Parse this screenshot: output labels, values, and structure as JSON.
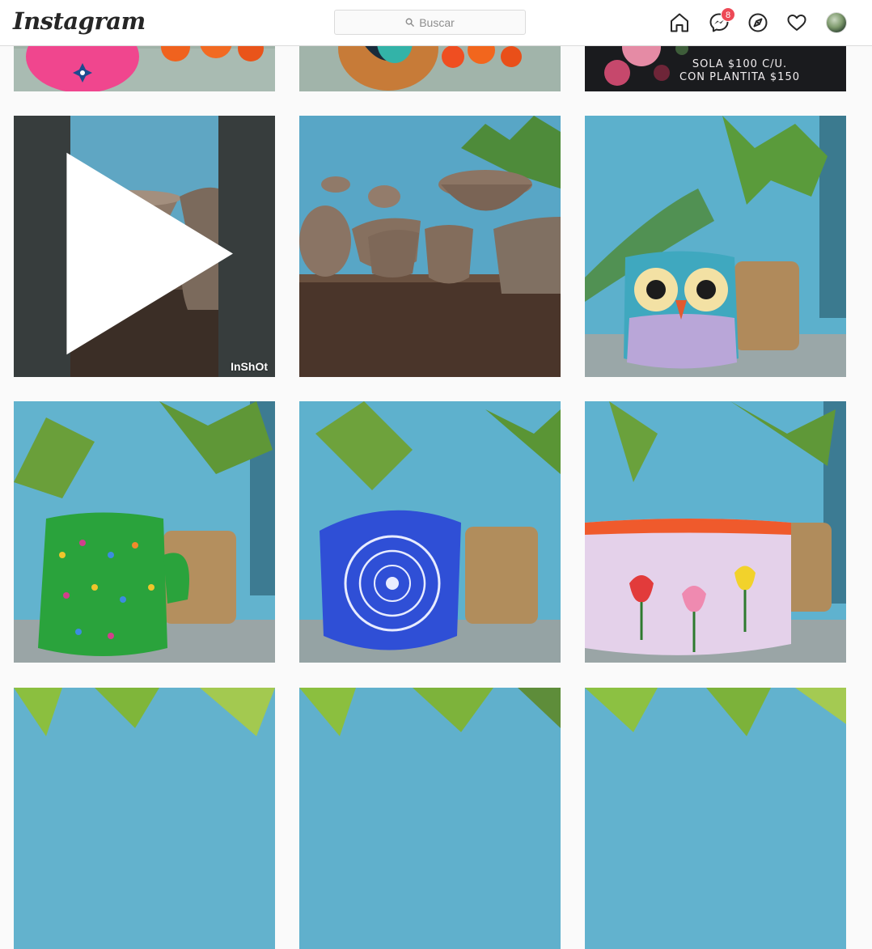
{
  "header": {
    "logo_text": "Instagram",
    "search_placeholder": "Buscar",
    "messages_badge": "8",
    "icons": [
      "home-icon",
      "messenger-icon",
      "explore-icon",
      "activity-heart-icon",
      "profile-avatar"
    ]
  },
  "posts": {
    "p1": {
      "subject": "pink-painted-pot-with-orange-flowers"
    },
    "p2": {
      "subject": "painted-terracotta-pot-turquoise"
    },
    "p3": {
      "promo_line1": "SOLA $100 C/U.",
      "promo_line2": "CON PLANTITA $150"
    },
    "p4": {
      "type": "video",
      "watermark": "InShOt",
      "subject": "unpainted-clay-pots-on-shelf"
    },
    "p5": {
      "subject": "unpainted-clay-pots-collection"
    },
    "p6": {
      "subject": "owl-painted-pot"
    },
    "p7": {
      "subject": "green-cactus-mug-with-dots"
    },
    "p8": {
      "subject": "blue-mandala-pot"
    },
    "p9": {
      "subject": "lilac-pot-with-tulips"
    },
    "p10": {
      "subject": "plant-partial"
    },
    "p11": {
      "subject": "plant-partial"
    },
    "p12": {
      "subject": "plant-partial"
    }
  },
  "colors": {
    "background": "#fafafa",
    "border": "#dbdbdb",
    "badge": "#ed4956",
    "wall_blue": "#5aa8c6"
  }
}
